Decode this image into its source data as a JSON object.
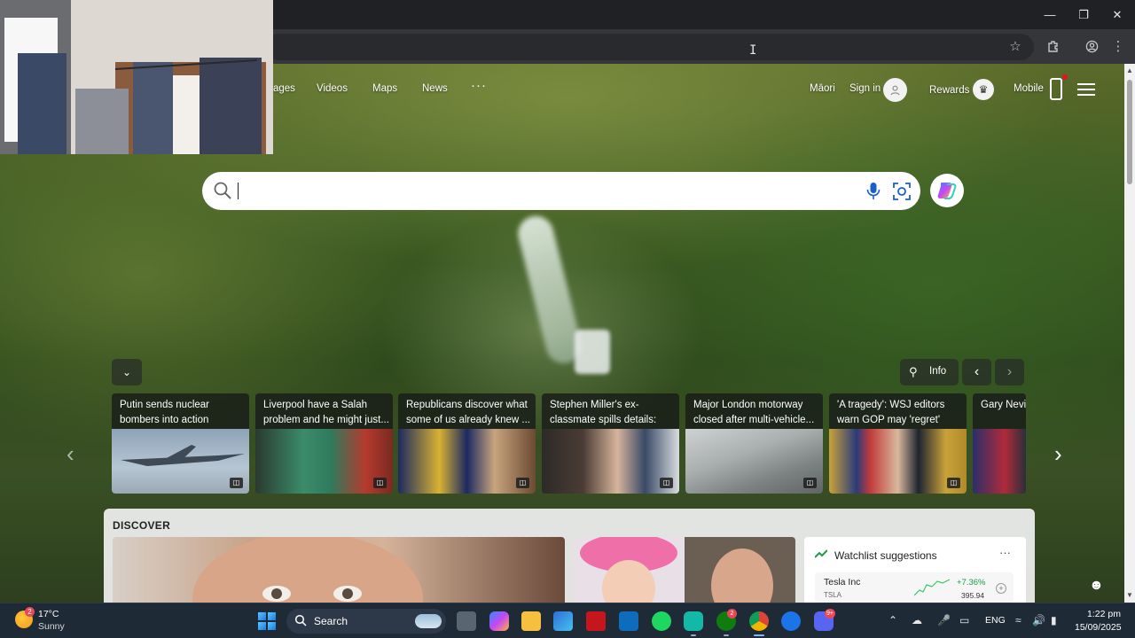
{
  "browser": {
    "window_controls": [
      "minimize",
      "maximize",
      "close"
    ]
  },
  "nav": {
    "links": [
      "ages",
      "Videos",
      "Maps",
      "News"
    ],
    "more_label": "···",
    "language": "Māori",
    "sign_in": "Sign in",
    "rewards": "Rewards",
    "mobile": "Mobile"
  },
  "search": {
    "placeholder": ""
  },
  "news": {
    "info_label": "Info",
    "items": [
      {
        "title": "Putin sends nuclear bombers into action"
      },
      {
        "title": "Liverpool have a Salah problem and he might just..."
      },
      {
        "title": "Republicans discover what some of us already knew ..."
      },
      {
        "title": "Stephen Miller's ex-classmate spills details: 'He..."
      },
      {
        "title": "Major London motorway closed after multi-vehicle..."
      },
      {
        "title": "'A tragedy': WSJ editors warn GOP may 'regret' thei..."
      },
      {
        "title": "Gary Nevill this film' ar"
      }
    ]
  },
  "discover": {
    "title": "DISCOVER",
    "watchlist": {
      "title": "Watchlist suggestions",
      "more": "···",
      "stock": {
        "name": "Tesla Inc",
        "ticker": "TSLA",
        "change": "+7.36%",
        "price": "395.94"
      }
    }
  },
  "taskbar": {
    "weather": {
      "temp": "17°C",
      "condition": "Sunny",
      "badge": "2"
    },
    "search_label": "Search",
    "chrome_badge": "2",
    "discord_badge": "9+",
    "language": "ENG",
    "time": "1:22 pm",
    "date": "15/09/2025"
  },
  "colors": {
    "taskbar_bg": "#1f2a37",
    "chrome_bg": "#35363a",
    "stock_up": "#1a9a4a"
  }
}
